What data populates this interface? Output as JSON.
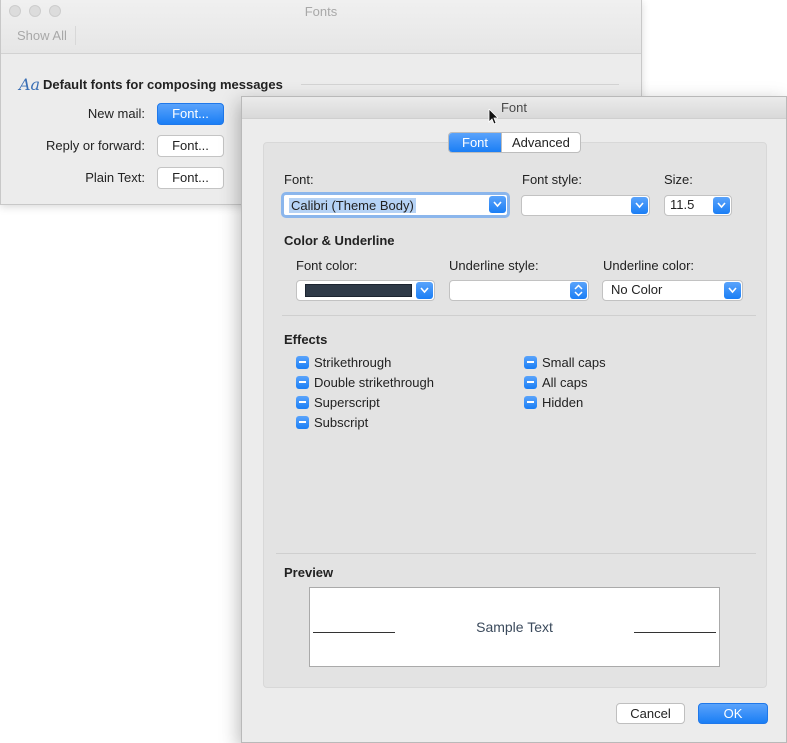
{
  "bg_window": {
    "title": "Fonts",
    "show_all": "Show All",
    "section_icon_glyph": "Aa",
    "section_title": "Default fonts for composing messages",
    "rows": [
      {
        "label": "New mail:",
        "button": "Font..."
      },
      {
        "label": "Reply or forward:",
        "button": "Font..."
      },
      {
        "label": "Plain Text:",
        "button": "Font..."
      }
    ]
  },
  "dialog": {
    "title": "Font",
    "tabs": [
      {
        "label": "Font",
        "active": true
      },
      {
        "label": "Advanced",
        "active": false
      }
    ],
    "font_label": "Font:",
    "font_value": "Calibri (Theme Body)",
    "font_style_label": "Font style:",
    "font_style_value": "",
    "size_label": "Size:",
    "size_value": "11.5",
    "color_section": "Color & Underline",
    "font_color_label": "Font color:",
    "font_color_value": "#2f3a48",
    "underline_style_label": "Underline style:",
    "underline_style_value": "",
    "underline_color_label": "Underline color:",
    "underline_color_value": "No Color",
    "effects_title": "Effects",
    "effects_left": [
      "Strikethrough",
      "Double strikethrough",
      "Superscript",
      "Subscript"
    ],
    "effects_right": [
      "Small caps",
      "All caps",
      "Hidden"
    ],
    "preview_title": "Preview",
    "preview_text": "Sample Text",
    "cancel_label": "Cancel",
    "ok_label": "OK"
  },
  "colors": {
    "accent": "#1a7ef5",
    "window_bg": "#ececec",
    "panel_bg": "#e3e3e3"
  }
}
